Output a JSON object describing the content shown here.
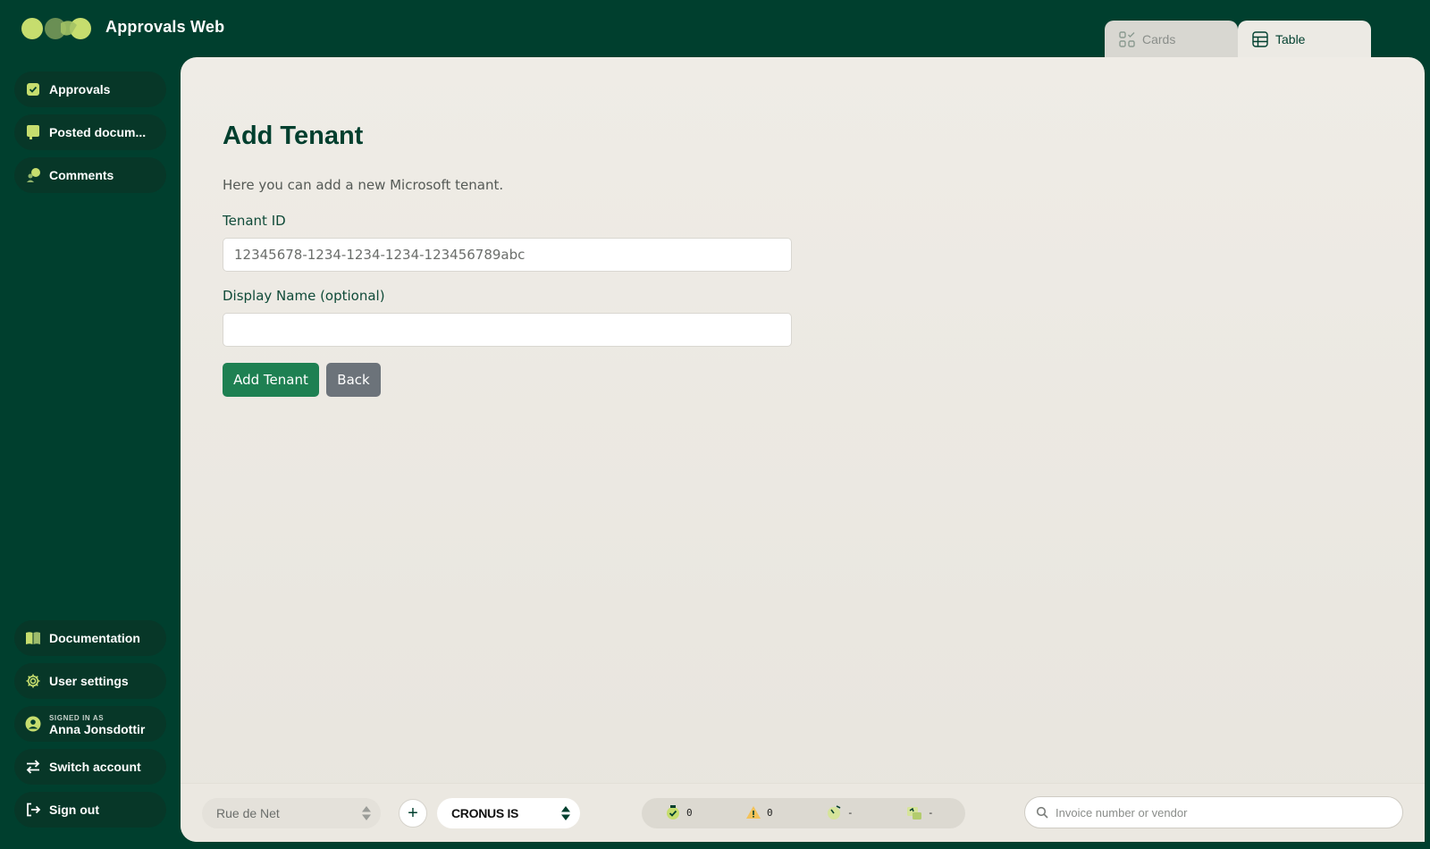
{
  "app": {
    "title": "Approvals Web"
  },
  "view_tabs": [
    {
      "label": "Cards",
      "icon": "cards-icon",
      "active": false
    },
    {
      "label": "Table",
      "icon": "table-icon",
      "active": true
    }
  ],
  "sidebar": {
    "top_items": [
      {
        "label": "Approvals",
        "icon": "approval-check-icon"
      },
      {
        "label": "Posted docum...",
        "icon": "posted-document-icon"
      },
      {
        "label": "Comments",
        "icon": "comments-icon"
      }
    ],
    "documentation": {
      "label": "Documentation",
      "icon": "book-icon"
    },
    "user_settings": {
      "label": "User settings",
      "icon": "gear-icon"
    },
    "signed_in": {
      "caption": "SIGNED IN AS",
      "name": "Anna Jonsdottir",
      "icon": "user-avatar-icon"
    },
    "switch_account": {
      "label": "Switch account",
      "icon": "switch-arrows-icon"
    },
    "sign_out": {
      "label": "Sign out",
      "icon": "sign-out-icon"
    }
  },
  "form": {
    "title": "Add Tenant",
    "description": "Here you can add a new Microsoft tenant.",
    "tenant_id": {
      "label": "Tenant ID",
      "placeholder": "12345678-1234-1234-1234-123456789abc",
      "value": ""
    },
    "display_name": {
      "label": "Display Name (optional)",
      "placeholder": "",
      "value": ""
    },
    "submit_label": "Add Tenant",
    "back_label": "Back"
  },
  "bottom_bar": {
    "company_select": {
      "value": "Rue de Net"
    },
    "add_label": "+",
    "environment_select": {
      "value": "CRONUS IS"
    },
    "stats": [
      {
        "icon": "approved-icon",
        "value": "0"
      },
      {
        "icon": "warning-icon",
        "value": "0"
      },
      {
        "icon": "pending-clock-icon",
        "value": "-"
      },
      {
        "icon": "document-stack-icon",
        "value": "-"
      }
    ],
    "search": {
      "placeholder": "Invoice number or vendor"
    }
  },
  "colors": {
    "background": "#003f2e",
    "panel": "#eceae4",
    "accent_lime": "#c6dd6e",
    "primary_button": "#1e8052",
    "secondary_button": "#6c737a"
  }
}
